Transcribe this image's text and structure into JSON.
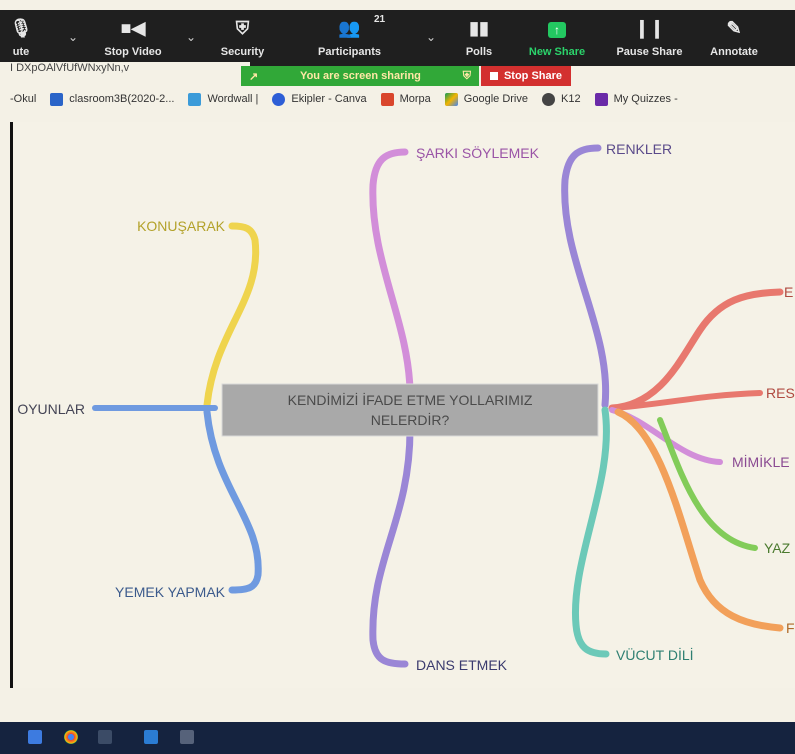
{
  "zoom_toolbar": {
    "items": [
      {
        "label": "ute",
        "icon": "microphone-icon"
      },
      {
        "label": "Stop Video",
        "icon": "video-camera-icon"
      },
      {
        "label": "Security",
        "icon": "shield-icon"
      },
      {
        "label": "Participants",
        "icon": "participants-icon",
        "count": "21"
      },
      {
        "label": "Polls",
        "icon": "poll-bars-icon"
      },
      {
        "label": "New Share",
        "icon": "share-up-arrow-icon"
      },
      {
        "label": "Pause Share",
        "icon": "pause-icon"
      },
      {
        "label": "Annotate",
        "icon": "pencil-icon"
      }
    ],
    "partial_text": "I  DXpOAlVfUfWNxyNn,v"
  },
  "share_banner": {
    "text": "You are screen sharing",
    "stop_label": "Stop Share"
  },
  "bookmarks": [
    {
      "label": "-Okul",
      "color": "#ffffff"
    },
    {
      "label": "clasroom3B(2020-2...",
      "color": "#2a64c8"
    },
    {
      "label": "Wordwall |",
      "color": "#3b9bd9"
    },
    {
      "label": "Ekipler - Canva",
      "color": "#2d5ed6"
    },
    {
      "label": "Morpa",
      "color": "#d9462c"
    },
    {
      "label": "Google Drive",
      "color": "#f4b400"
    },
    {
      "label": "K12",
      "color": "#444444"
    },
    {
      "label": "My Quizzes -",
      "color": "#6a2aa8"
    }
  ],
  "mindmap": {
    "center": [
      "KENDİMİZİ İFADE ETME YOLLARIMIZ",
      "NELERDİR?"
    ],
    "branches": {
      "konusarak": "KONUŞARAK",
      "oyunlar": "OYUNLAR",
      "yemek": "YEMEK YAPMAK",
      "sarki": "ŞARKI SÖYLEMEK",
      "dans": "DANS ETMEK",
      "renkler": "RENKLER",
      "vucut": "VÜCUT DİLİ",
      "e": "E",
      "res": "RES",
      "mimik": "MİMİKLE",
      "yaz": "YAZ",
      "f": "F"
    },
    "colors": {
      "yellow": "#efd44e",
      "blue": "#6f9ae0",
      "pink": "#d28ed9",
      "purple": "#9a86d6",
      "teal": "#6cc9b8",
      "red": "#e8786e",
      "green": "#82cc59",
      "orange": "#f2a05a",
      "center_bg": "#a9a9a9"
    }
  }
}
